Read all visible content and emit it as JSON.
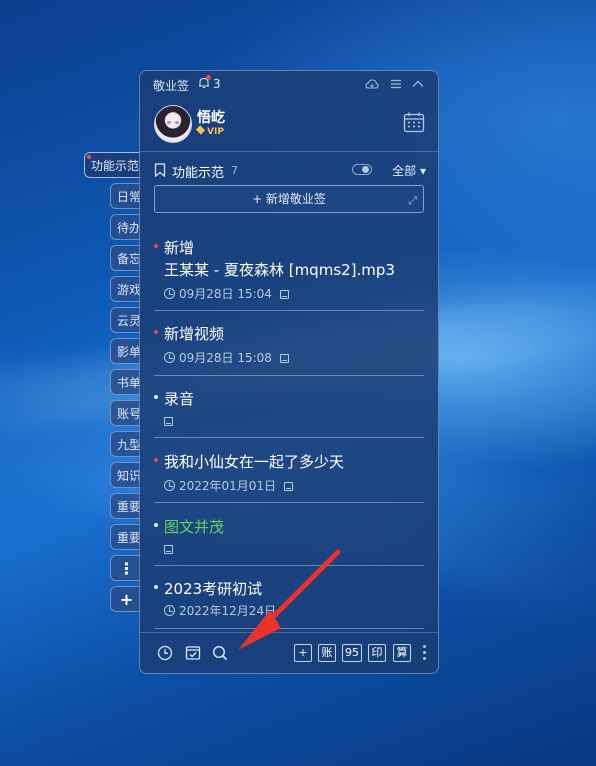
{
  "app": {
    "title": "敬业签",
    "notification_count": "3"
  },
  "user": {
    "name": "悟屹",
    "badge": "VIP"
  },
  "side_tabs": [
    {
      "label": "功能示范",
      "active": true
    },
    {
      "label": "日常"
    },
    {
      "label": "待办"
    },
    {
      "label": "备忘"
    },
    {
      "label": "游戏"
    },
    {
      "label": "云灵"
    },
    {
      "label": "影单"
    },
    {
      "label": "书单"
    },
    {
      "label": "账号"
    },
    {
      "label": "九型"
    },
    {
      "label": "知识"
    },
    {
      "label": "重要"
    },
    {
      "label": "重要"
    }
  ],
  "side_actions": {
    "more": "⋮",
    "add": "+"
  },
  "category": {
    "name": "功能示范",
    "count": "7",
    "filter": "全部 ▾"
  },
  "add_note_label": "+ 新增敬业签",
  "notes": [
    {
      "title": "新增",
      "subtitle": "王某某 - 夏夜森林 [mqms2].mp3",
      "time": "09月28日 15:04",
      "dot_color": "#e84b4b"
    },
    {
      "title": "新增视频",
      "time": "09月28日 15:08",
      "dot_color": "#e84b4b"
    },
    {
      "title": "录音",
      "dot_color": "#dfe9f8"
    },
    {
      "title": "我和小仙女在一起了多少天",
      "time": "2022年01月01日",
      "dot_color": "#e84b4b"
    },
    {
      "title": "图文并茂",
      "dot_color": "#dfe9f8",
      "title_color": "#5fd25f"
    },
    {
      "title": "2023考研初试",
      "time": "2022年12月24日",
      "dot_color": "#dfe9f8"
    }
  ],
  "toolbar": {
    "add": "+",
    "account": "账",
    "nine_five": "95",
    "print": "印",
    "calc": "算"
  },
  "icons": {
    "history": "clock-icon",
    "todo": "checkbox-icon",
    "search": "search-icon",
    "cloud": "cloud-icon",
    "menu": "menu-icon",
    "collapse": "chevron-up-icon",
    "calendar": "calendar-icon"
  },
  "colors": {
    "accent_red": "#e84b4b",
    "vip_gold": "#f4c44a",
    "highlight_green": "#5fd25f",
    "annotation_arrow": "#e8332a"
  }
}
